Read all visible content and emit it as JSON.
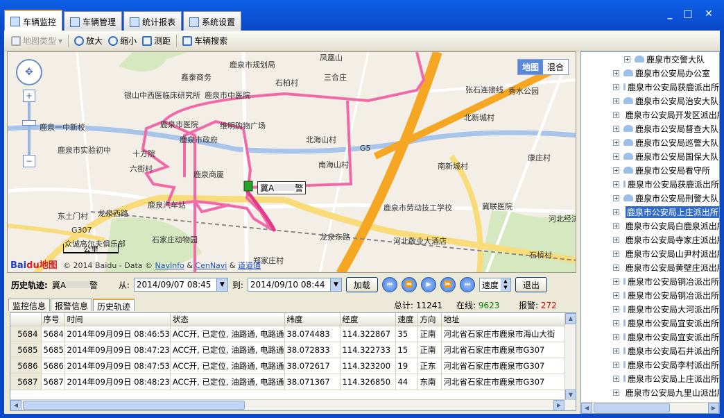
{
  "window": {
    "controls": [
      "_",
      "□",
      "✕"
    ]
  },
  "tabs": [
    {
      "label": "车辆监控",
      "active": true
    },
    {
      "label": "车辆管理",
      "active": false
    },
    {
      "label": "统计报表",
      "active": false
    },
    {
      "label": "系统设置",
      "active": false
    }
  ],
  "toolbar": {
    "map_type": "地图类型",
    "zoom_in": "放大",
    "zoom_out": "缩小",
    "measure": "测距",
    "vehicle_search": "车辆搜索"
  },
  "map": {
    "map_button": "地图",
    "hybrid_button": "混合",
    "scale": "公里",
    "logo_bai": "Bai",
    "logo_du": "du",
    "logo_map": "地图",
    "copyright_prefix": "© 2014 Baidu - Data ©",
    "copyright_navinfo": "NavInfo",
    "copyright_amp": "&",
    "copyright_cennavi": "CenNavi",
    "copyright_amp2": "&",
    "copyright_daodaotong": "道道通",
    "vehicle_label": "冀A",
    "vehicle_label_suffix": "警",
    "places": [
      "鹿泉市规划局",
      "凤凰山",
      "三合庄",
      "石柏村",
      "鑫泰商务",
      "鹿泉市中医院",
      "银山中西医临床研究所",
      "鹿泉市医院",
      "维明购物广场",
      "北海山村",
      "鹿泉一中新校",
      "鹿泉市政府",
      "鹿泉市实验初中",
      "十方院",
      "南海山村",
      "六街村",
      "鹿泉商厦",
      "鹿泉汽车站",
      "鹿泉市劳动技工学校",
      "冀联医院",
      "东土门村",
      "河北敬业大酒店",
      "众诚高尔夫俱乐部",
      "石家庄动物园",
      "郑家庄村",
      "北新城村",
      "南新城村",
      "康庄村",
      "秀水公园",
      "张石连接线",
      "龙泉西路",
      "龙泉东路",
      "G307",
      "G5",
      "石桥村",
      "河北经济管理学校"
    ]
  },
  "history": {
    "label": "历史轨迹:",
    "plate": "冀A",
    "plate_suffix": "警",
    "from_label": "从:",
    "from_value": "2014/09/07 08:45",
    "to_label": "到:",
    "to_value": "2014/09/10 08:44",
    "load_button": "加载",
    "speed_label": "速度",
    "exit_button": "退出"
  },
  "bottom_tabs": [
    {
      "label": "监控信息",
      "active": false
    },
    {
      "label": "报警信息",
      "active": false
    },
    {
      "label": "历史轨迹",
      "active": true
    }
  ],
  "stats": {
    "total_label": "总计:",
    "total_value": "11241",
    "online_label": "在线:",
    "online_value": "9623",
    "alarm_label": "报警:",
    "alarm_value": "272"
  },
  "grid": {
    "columns": [
      "序号",
      "时间",
      "状态",
      "纬度",
      "经度",
      "速度",
      "方向",
      "地址"
    ],
    "rows": [
      [
        "5684",
        "5684",
        "2014年09月09日 08:46:53",
        "ACC开, 已定位, 油路通, 电路通",
        "38.074483",
        "114.322867",
        "35",
        "正南",
        "河北省石家庄市鹿泉市海山大街"
      ],
      [
        "5685",
        "5685",
        "2014年09月09日 08:47:23",
        "ACC开, 已定位, 油路通, 电路通",
        "38.072833",
        "114.322733",
        "15",
        "正南",
        "河北省石家庄市鹿泉市G307"
      ],
      [
        "5686",
        "5686",
        "2014年09月09日 08:47:53",
        "ACC开, 已定位, 油路通, 电路通",
        "38.072617",
        "114.323200",
        "19",
        "正东",
        "河北省石家庄市鹿泉市G307"
      ],
      [
        "5687",
        "5687",
        "2014年09月09日 08:48:23",
        "ACC开, 已定位, 油路通, 电路通",
        "38.071367",
        "114.326850",
        "44",
        "东南",
        "河北省石家庄市鹿泉市G307"
      ]
    ]
  },
  "tree": {
    "items": [
      {
        "label": "鹿泉市交警大队",
        "selected": false,
        "indent": 1
      },
      {
        "label": "鹿泉市公安局办公室",
        "selected": false,
        "indent": 0
      },
      {
        "label": "鹿泉市公安局获鹿派出所",
        "selected": false,
        "indent": 0
      },
      {
        "label": "鹿泉市公安局治安大队",
        "selected": false,
        "indent": 0
      },
      {
        "label": "鹿泉市公安局开发区派出所",
        "selected": false,
        "indent": 0
      },
      {
        "label": "鹿泉市公安局督查大队",
        "selected": false,
        "indent": 0
      },
      {
        "label": "鹿泉市公安局巡警大队",
        "selected": false,
        "indent": 0
      },
      {
        "label": "鹿泉市公安局国保大队",
        "selected": false,
        "indent": 0
      },
      {
        "label": "鹿泉市公安局看守所",
        "selected": false,
        "indent": 0
      },
      {
        "label": "鹿泉市公安局获鹿派出所",
        "selected": false,
        "indent": 0
      },
      {
        "label": "鹿泉市公安局刑警大队",
        "selected": false,
        "indent": 0
      },
      {
        "label": "鹿泉市公安局上庄派出所",
        "selected": true,
        "indent": 0
      },
      {
        "label": "鹿泉市公安局白鹿泉派出所",
        "selected": false,
        "indent": 0
      },
      {
        "label": "鹿泉市公安局寺家庄派出所",
        "selected": false,
        "indent": 0
      },
      {
        "label": "鹿泉市公安局山尹村派出所",
        "selected": false,
        "indent": 0
      },
      {
        "label": "鹿泉市公安局黄壁庄派出所",
        "selected": false,
        "indent": 0
      },
      {
        "label": "鹿泉市公安局铜冶派出所",
        "selected": false,
        "indent": 0
      },
      {
        "label": "鹿泉市公安局铜冶派出所",
        "selected": false,
        "indent": 0
      },
      {
        "label": "鹿泉市公安局大河派出所",
        "selected": false,
        "indent": 0
      },
      {
        "label": "鹿泉市公安局宜安派出所",
        "selected": false,
        "indent": 0
      },
      {
        "label": "鹿泉市公安局宜安派出所",
        "selected": false,
        "indent": 0
      },
      {
        "label": "鹿泉市公安局石井派出所",
        "selected": false,
        "indent": 0
      },
      {
        "label": "鹿泉市公安局李村派出所",
        "selected": false,
        "indent": 0
      },
      {
        "label": "鹿泉市公安局上庄派出所",
        "selected": false,
        "indent": 0
      },
      {
        "label": "鹿泉市公安局九里山派出所",
        "selected": false,
        "indent": 0
      }
    ]
  },
  "colors": {
    "accent": "#0b48c8",
    "track": "#f06aa8",
    "highway": "#f5a623",
    "online": "#008000",
    "alarm": "#d00000"
  }
}
